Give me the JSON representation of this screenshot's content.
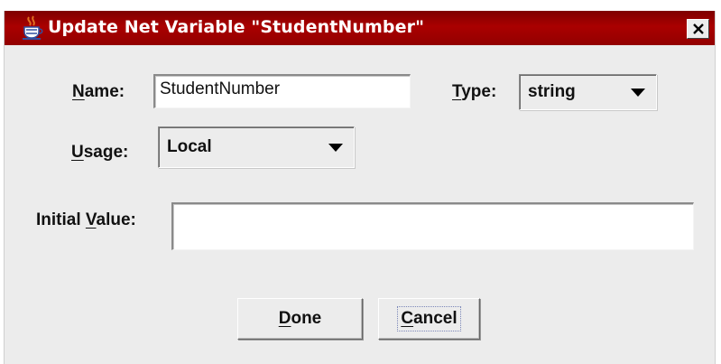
{
  "window": {
    "title": "Update Net Variable \"StudentNumber\"",
    "title_bar_color": "#a00000"
  },
  "icons": {
    "app": "java-coffee-cup-icon",
    "close": "close-x-icon"
  },
  "form": {
    "name_label_mnemonic": "N",
    "name_label_rest": "ame:",
    "name_value": "StudentNumber",
    "type_label_mnemonic": "T",
    "type_label_rest": "ype:",
    "type_selected": "string",
    "usage_label_mnemonic": "U",
    "usage_label_rest": "sage:",
    "usage_selected": "Local",
    "initial_label_prefix": "Initial ",
    "initial_label_mnemonic": "V",
    "initial_label_rest": "alue:",
    "initial_value": ""
  },
  "buttons": {
    "done_mnemonic": "D",
    "done_rest": "one",
    "cancel_mnemonic": "C",
    "cancel_rest": "ancel"
  }
}
